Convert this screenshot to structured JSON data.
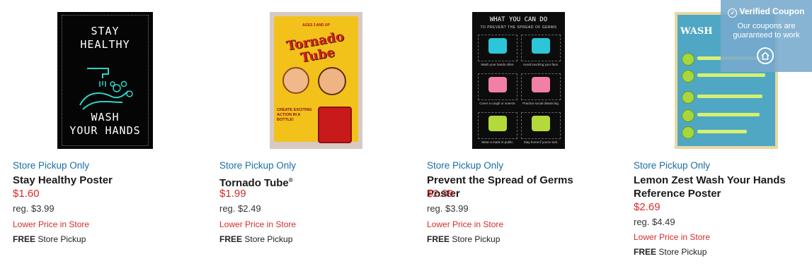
{
  "coupon": {
    "title": "Verified Coupon",
    "body": "Our coupons are guaranteed to work",
    "check_icon": "check-circle-icon",
    "home_icon": "home-icon"
  },
  "products": [
    {
      "pickup": "Store Pickup Only",
      "title": "Stay Healthy Poster",
      "price": "$1.60",
      "reg": "reg. $3.99",
      "lower": "Lower Price in Store",
      "free_bold": "FREE",
      "free_rest": "Store Pickup",
      "poster": {
        "line1": "STAY",
        "line2": "HEALTHY",
        "line3": "WASH",
        "line4": "YOUR HANDS"
      }
    },
    {
      "pickup": "Store Pickup Only",
      "title": "Tornado Tube",
      "title_mark": "®",
      "price": "$1.99",
      "reg": "reg. $2.49",
      "lower": "Lower Price in Store",
      "free_bold": "FREE",
      "free_rest": "Store Pickup",
      "poster": {
        "ages": "AGES 3 AND UP",
        "logo1": "Tornado",
        "logo2": "Tube",
        "bubble": "CREATE EXCITING ACTION IN A BOTTLE!"
      }
    },
    {
      "pickup": "Store Pickup Only",
      "title": "Prevent the Spread of Germs Poster",
      "price": "$2.39",
      "reg": "reg. $3.99",
      "lower": "Lower Price in Store",
      "free_bold": "FREE",
      "free_rest": "Store Pickup",
      "poster": {
        "header": "WHAT YOU CAN DO",
        "sub": "TO PREVENT THE SPREAD OF GERMS",
        "tiles": [
          "Wash your hands often.",
          "Avoid touching your face.",
          "Cover a cough or sneeze.",
          "Practice social distancing.",
          "Wear a mask in public.",
          "Stay home if you're sick."
        ]
      }
    },
    {
      "pickup": "Store Pickup Only",
      "title": "Lemon Zest Wash Your Hands Reference Poster",
      "price": "$2.69",
      "reg": "reg. $4.49",
      "lower": "Lower Price in Store",
      "free_bold": "FREE",
      "free_rest": "Store Pickup",
      "poster": {
        "head": "WASH"
      }
    }
  ],
  "colors": {
    "link_blue": "#1a6fa3",
    "price_red": "#d62b2b",
    "coupon_bg": "#78aacd"
  }
}
